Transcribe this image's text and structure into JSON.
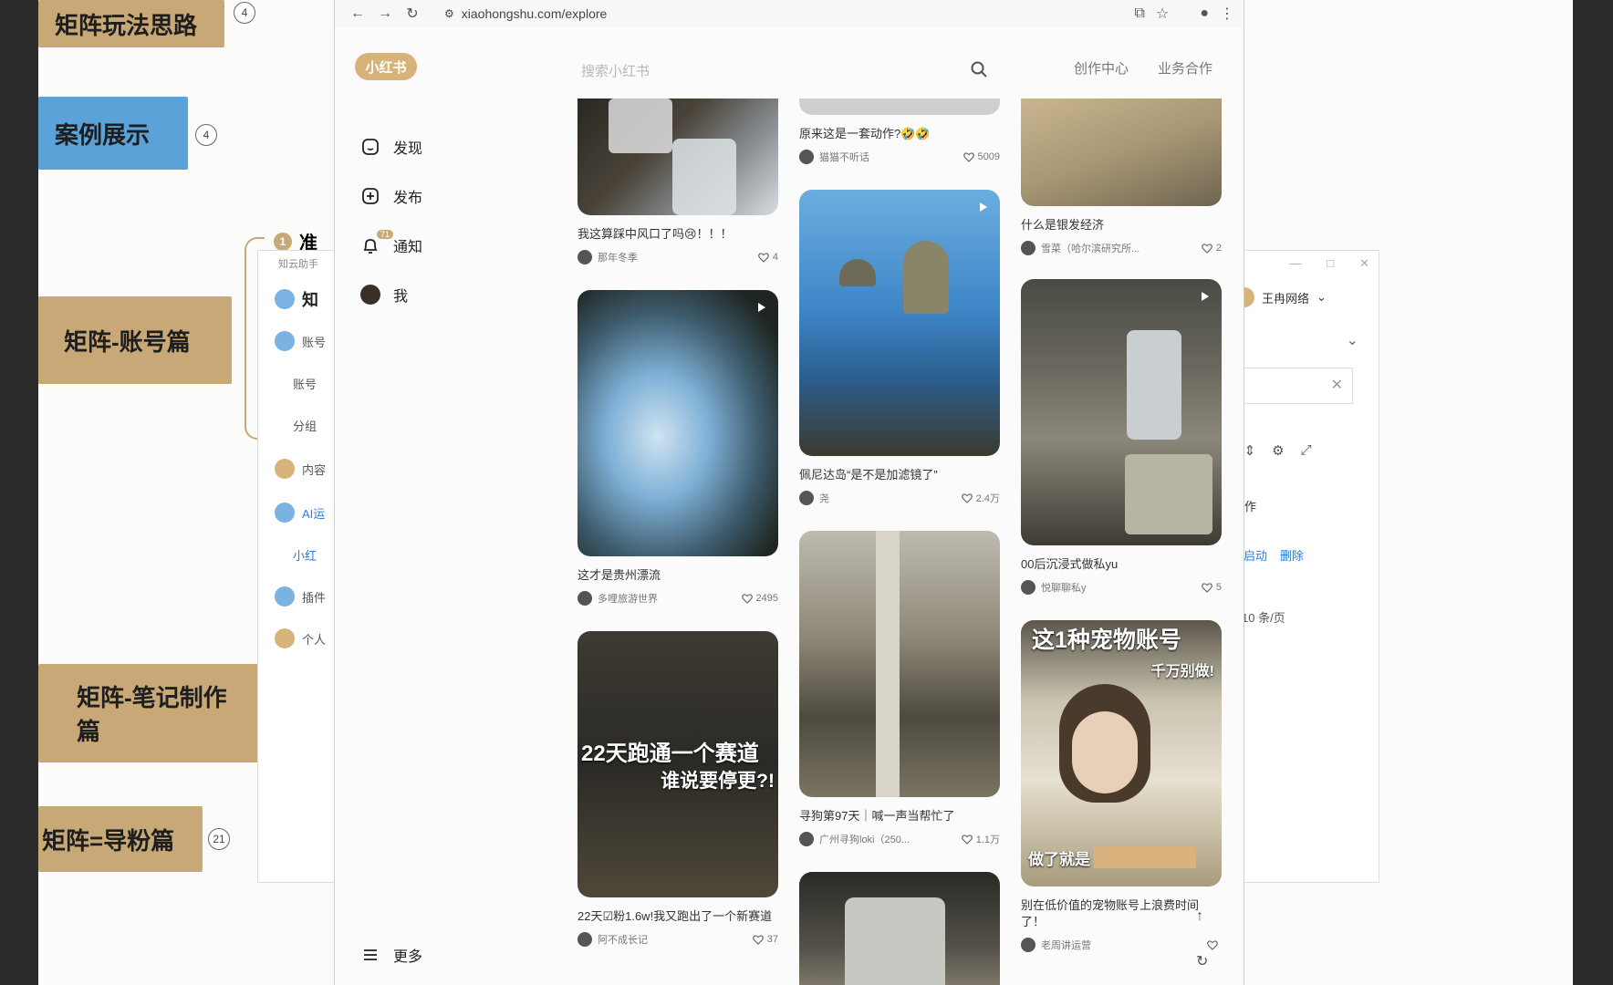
{
  "mindmap": {
    "nodes": [
      {
        "id": "mm-1",
        "label": "矩阵玩法思路",
        "badge": "4"
      },
      {
        "id": "mm-2",
        "label": "案例展示",
        "badge": "4"
      },
      {
        "id": "mm-3",
        "label": "矩阵-账号篇",
        "badge": ""
      },
      {
        "id": "mm-4",
        "label": "矩阵-笔记制作篇",
        "badge": ""
      },
      {
        "id": "mm-5",
        "label": "矩阵=导粉篇",
        "badge": "21"
      }
    ],
    "sub_badge": "1",
    "sub_label": "准"
  },
  "side_panel": {
    "title": "知云助手",
    "items": [
      "知",
      "账号",
      "账号",
      "分组",
      "内容",
      "AI运",
      "小红",
      "插件",
      "个人"
    ]
  },
  "bg_app": {
    "user": "王冉网络",
    "action": "操作",
    "start": "启动",
    "delete": "删除",
    "per_page": "10 条/页"
  },
  "browser": {
    "url": "xiaohongshu.com/explore"
  },
  "xhs": {
    "logo": "小红书",
    "search_placeholder": "搜索小红书",
    "top_links": [
      "创作中心",
      "业务合作"
    ],
    "nav": [
      {
        "label": "发现",
        "icon": "discover-icon"
      },
      {
        "label": "发布",
        "icon": "publish-icon"
      },
      {
        "label": "通知",
        "icon": "bell-icon",
        "badge": "71"
      },
      {
        "label": "我",
        "icon": "avatar-icon"
      }
    ],
    "more": "更多",
    "cards": [
      {
        "title": "我这算踩中风口了吗😢！！！",
        "author": "那年冬季",
        "likes": "4"
      },
      {
        "title": "这才是贵州漂流",
        "author": "多哩旅游世界",
        "likes": "2495"
      },
      {
        "title": "22天☑粉1.6w!我又跑出了一个新赛道",
        "author": "阿不成长记",
        "likes": "37",
        "overlay1": "22天跑通一个赛道",
        "overlay2": "谁说要停更?!"
      },
      {
        "title": "原来这是一套动作?🤣🤣",
        "author": "猫猫不听话",
        "likes": "5009"
      },
      {
        "title": "佩尼达岛“是不是加滤镜了”",
        "author": "尧",
        "likes": "2.4万"
      },
      {
        "title": "寻狗第97天｜喊一声当帮忙了",
        "author": "广州寻狗loki（250...",
        "likes": "1.1万"
      },
      {
        "title": "什么是银发经济",
        "author": "雪菜（哈尔滨研究所...",
        "likes": "2"
      },
      {
        "title": "00后沉浸式做私yu",
        "author": "悦聊聊私y",
        "likes": "5"
      },
      {
        "title": "别在低价值的宠物账号上浪费时间了！",
        "author": "老周讲运营",
        "likes": "",
        "overlay1": "这1种宠物账号",
        "overlay2": "千万别做!",
        "overlay3": "做了就是"
      }
    ]
  }
}
